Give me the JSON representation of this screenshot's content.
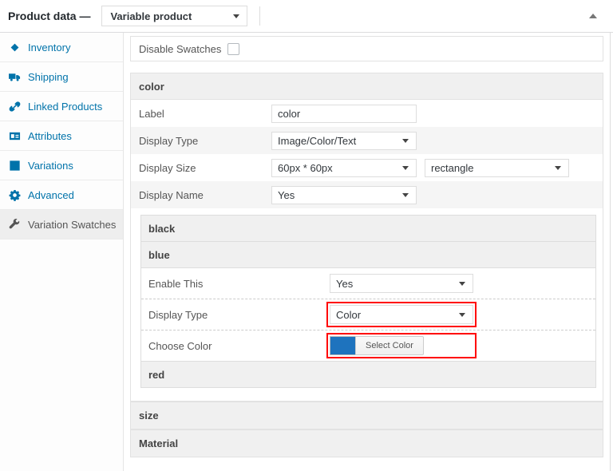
{
  "header": {
    "title": "Product data —",
    "product_type": "Variable product"
  },
  "sidebar": [
    {
      "label": "Inventory",
      "icon": "inventory-icon"
    },
    {
      "label": "Shipping",
      "icon": "shipping-icon"
    },
    {
      "label": "Linked Products",
      "icon": "linked-products-icon"
    },
    {
      "label": "Attributes",
      "icon": "attributes-icon"
    },
    {
      "label": "Variations",
      "icon": "variations-icon"
    },
    {
      "label": "Advanced",
      "icon": "advanced-icon"
    },
    {
      "label": "Variation Swatches",
      "icon": "wrench-icon",
      "active": true
    }
  ],
  "content": {
    "disable_swatches_label": "Disable Swatches",
    "disable_swatches_checked": false,
    "color_section": {
      "title": "color",
      "rows": {
        "label": {
          "label": "Label",
          "value": "color"
        },
        "display_type": {
          "label": "Display Type",
          "value": "Image/Color/Text"
        },
        "display_size": {
          "label": "Display Size",
          "value": "60px * 60px",
          "value2": "rectangle"
        },
        "display_name": {
          "label": "Display Name",
          "value": "Yes"
        }
      },
      "terms": {
        "black": {
          "title": "black"
        },
        "blue": {
          "title": "blue",
          "enable_this": {
            "label": "Enable This",
            "value": "Yes"
          },
          "display_type": {
            "label": "Display Type",
            "value": "Color"
          },
          "choose_color": {
            "label": "Choose Color",
            "button": "Select Color",
            "swatch_color": "#1e73be"
          }
        },
        "red": {
          "title": "red"
        }
      }
    },
    "size_section": {
      "title": "size"
    },
    "material_section": {
      "title": "Material"
    }
  },
  "colors": {
    "link_blue": "#0073aa",
    "highlight_red": "#ff0000",
    "swatch_blue": "#1e73be",
    "active_tab_bg": "#eeeeee"
  }
}
